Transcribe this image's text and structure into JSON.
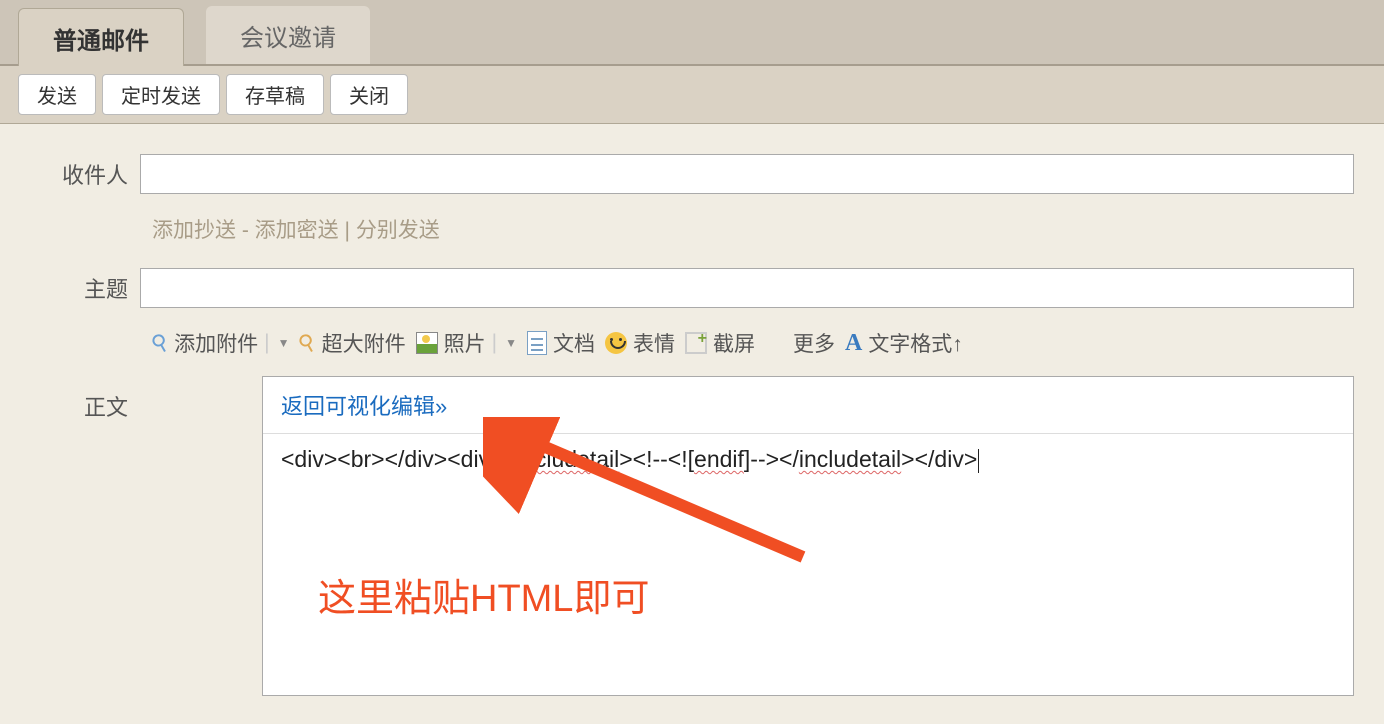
{
  "tabs": {
    "compose": "普通邮件",
    "meeting": "会议邀请"
  },
  "toolbar": {
    "send": "发送",
    "timed_send": "定时发送",
    "save_draft": "存草稿",
    "close": "关闭"
  },
  "form": {
    "to_label": "收件人",
    "to_value": "",
    "links": {
      "add_cc": "添加抄送",
      "sep1": " - ",
      "add_bcc": "添加密送",
      "sep2": "  |  ",
      "send_separately": "分别发送"
    },
    "subject_label": "主题",
    "subject_value": "",
    "attach": {
      "add_attachment": "添加附件",
      "large_attachment": "超大附件",
      "photo": "照片",
      "document": "文档",
      "emoji": "表情",
      "screenshot": "截屏",
      "more": "更多",
      "text_format": "文字格式↑"
    },
    "body_label": "正文",
    "body": {
      "return_visual": "返回可视化编辑»",
      "content_part1": "<div><br></div><div><",
      "content_word1": "includetail",
      "content_part2": "><!--<![",
      "content_word2": "endif",
      "content_part3": "]--></",
      "content_word3": "includetail",
      "content_part4": "></div>"
    }
  },
  "annotation": "这里粘贴HTML即可"
}
